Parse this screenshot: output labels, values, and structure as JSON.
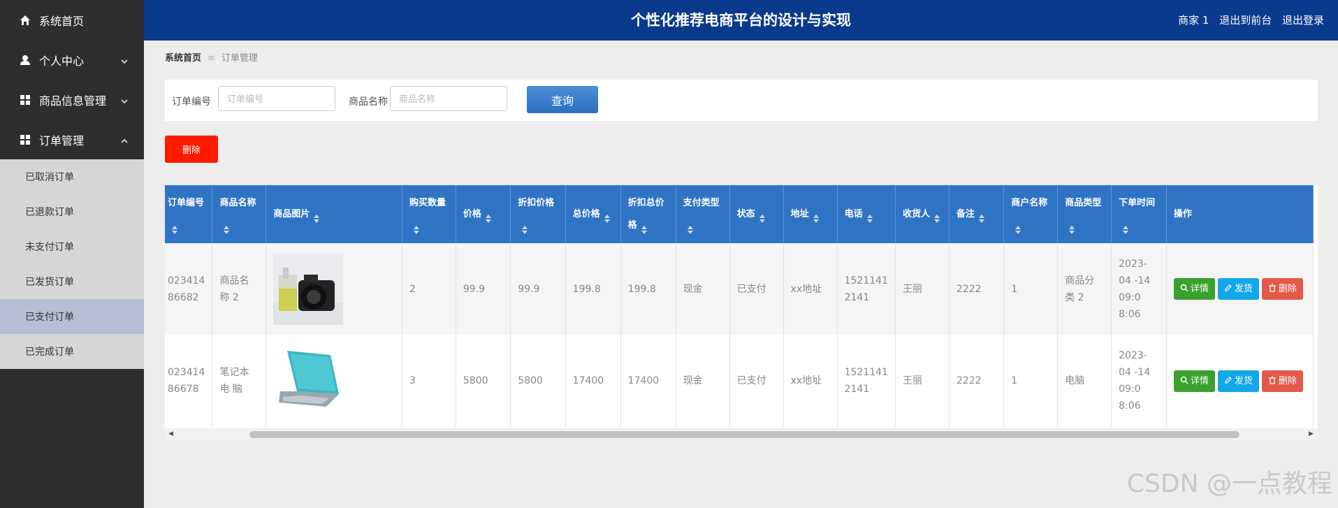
{
  "sidebar": {
    "items": [
      {
        "label": "系统首页",
        "icon": "home-icon"
      },
      {
        "label": "个人中心",
        "icon": "user-icon"
      },
      {
        "label": "商品信息管理",
        "icon": "grid-icon"
      },
      {
        "label": "订单管理",
        "icon": "grid-icon"
      }
    ],
    "submenu": [
      "已取消订单",
      "已退款订单",
      "未支付订单",
      "已发货订单",
      "已支付订单",
      "已完成订单"
    ],
    "active_submenu": "已支付订单"
  },
  "header": {
    "title": "个性化推荐电商平台的设计与实现",
    "user": "商家 1",
    "to_front": "退出到前台",
    "logout": "退出登录"
  },
  "breadcrumb": {
    "home": "系统首页",
    "sep": "≡",
    "current": "订单管理"
  },
  "search": {
    "order_no_label": "订单编号",
    "order_no_placeholder": "订单编号",
    "product_name_label": "商品名称",
    "product_name_placeholder": "商品名称",
    "query_button": "查询"
  },
  "toolbar": {
    "delete_label": "删除"
  },
  "table": {
    "headers": [
      "订单编号",
      "商品名称",
      "商品图片",
      "购买数量",
      "价格",
      "折扣价格",
      "总价格",
      "折扣总价格",
      "支付类型",
      "状态",
      "地址",
      "电话",
      "收货人",
      "备注",
      "商户名称",
      "商品类型",
      "下单时间",
      "操作"
    ],
    "rows": [
      {
        "order_no": "023414 86682",
        "name": "商品名称 2",
        "image": "camera-and-cup-photo",
        "qty": "2",
        "price": "99.9",
        "discount_price": "99.9",
        "total": "199.8",
        "discount_total": "199.8",
        "pay_type": "现金",
        "status": "已支付",
        "address": "xx地址",
        "phone": "1521141 2141",
        "receiver": "王丽",
        "remark": "2222",
        "merchant": "1",
        "category": "商品分类 2",
        "time": "2023-04 -14 09:0 8:06"
      },
      {
        "order_no": "023414 86678",
        "name": "笔记本电 脑",
        "image": "laptop-photo",
        "qty": "3",
        "price": "5800",
        "discount_price": "5800",
        "total": "17400",
        "discount_total": "17400",
        "pay_type": "现金",
        "status": "已支付",
        "address": "xx地址",
        "phone": "1521141 2141",
        "receiver": "王丽",
        "remark": "2222",
        "merchant": "1",
        "category": "电脑",
        "time": "2023-04 -14 09:0 8:06"
      }
    ],
    "actions": {
      "detail": "详情",
      "ship": "发货",
      "delete": "删除"
    }
  },
  "watermark": "CSDN @一点教程",
  "colors": {
    "header": "#0a3a8c",
    "sidebar": "#2e2e2e",
    "table_header": "#2f74c4",
    "delete": "#ff1a00",
    "detail": "#3aa12f",
    "ship": "#12a8e8"
  }
}
